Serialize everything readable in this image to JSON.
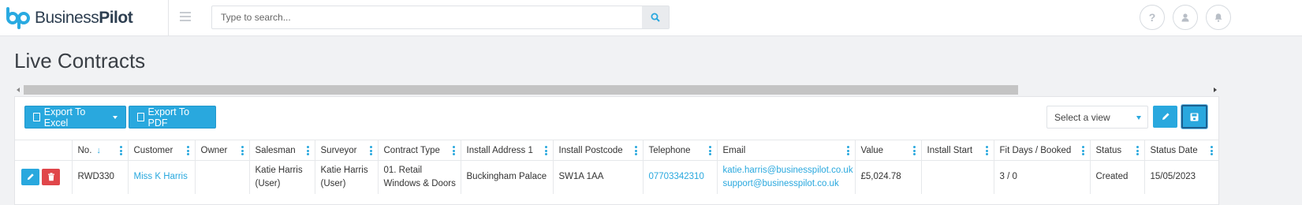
{
  "app": {
    "logo_text_regular": "Business",
    "logo_text_bold": "Pilot"
  },
  "search": {
    "placeholder": "Type to search..."
  },
  "header_icons": [
    "help-icon",
    "user-icon",
    "bell-icon"
  ],
  "page": {
    "title": "Live Contracts"
  },
  "toolbar": {
    "export_excel_label": "Export To Excel",
    "export_pdf_label": "Export To PDF",
    "select_view_value": "Select a view"
  },
  "table": {
    "columns": [
      "",
      "No.",
      "Customer",
      "Owner",
      "Salesman",
      "Surveyor",
      "Contract Type",
      "Install Address 1",
      "Install Postcode",
      "Telephone",
      "Email",
      "Value",
      "Install Start",
      "Fit Days / Booked",
      "Status",
      "Status Date"
    ],
    "sort_column": "No.",
    "rows": [
      {
        "no": "RWD330",
        "customer": "Miss K Harris",
        "owner": "",
        "salesman": "Katie Harris (User)",
        "surveyor": "Katie Harris (User)",
        "contract_type": "01. Retail Windows & Doors",
        "install_address": "Buckingham Palace",
        "install_postcode": "SW1A 1AA",
        "telephone": "07703342310",
        "email_1": "katie.harris@businesspilot.co.uk",
        "email_2": "support@businesspilot.co.uk",
        "value": "£5,024.78",
        "install_start": "",
        "fit_days": "3 / 0",
        "status": "Created",
        "status_date": "15/05/2023"
      }
    ]
  },
  "colors": {
    "accent": "#29a8de",
    "danger": "#e0464a",
    "logo": "#29aae1"
  }
}
